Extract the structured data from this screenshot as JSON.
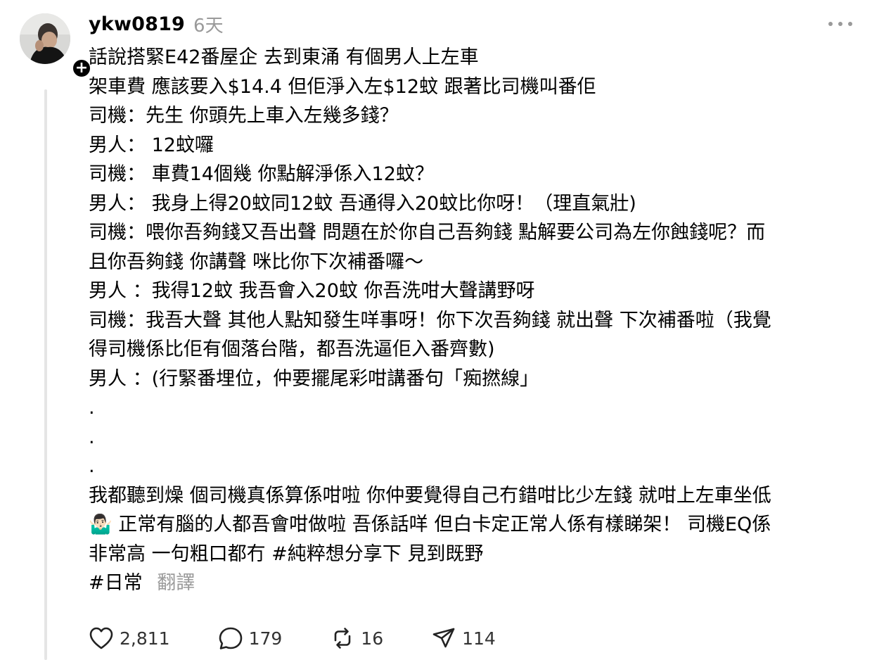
{
  "post": {
    "username": "ykw0819",
    "timestamp": "6天",
    "follow_badge": "+",
    "body_lines": [
      "話說搭緊E42番屋企 去到東涌 有個男人上左車",
      "架車費 應該要入$14.4 但佢淨入左$12蚊 跟著比司機叫番佢",
      "司機：先生 你頭先上車入左幾多錢？",
      "男人： 12蚊囉",
      "司機： 車費14個幾 你點解淨係入12蚊？",
      "男人： 我身上得20蚊同12蚊 吾通得入20蚊比你呀！（理直氣壯)",
      "司機：喂你吾夠錢又吾出聲 問題在於你自己吾夠錢 點解要公司為左你蝕錢呢？而",
      "且你吾夠錢 你講聲 咪比你下次補番囉～",
      "男人 ：我得12蚊 我吾會入20蚊 你吾洗咁大聲講野呀",
      "司機：我吾大聲 其他人點知發生咩事呀！你下次吾夠錢 就出聲 下次補番啦（我覺",
      "得司機係比佢有個落台階，都吾洗逼佢入番齊￼數)",
      "男人 ：(行緊番埋位，仲要擺尾彩咁講番句「痴撚線」",
      ".",
      ".",
      ".",
      "我都聽到燥 個司機真係算係咁啦 你仲要覺得自己冇錯咁比少左錢 就咁上左車坐低",
      "🤷🏻‍♂️ 正常有腦的人都吾會咁做啦 吾係話咩 但白卡定正常人係有樣睇架！ 司機EQ係",
      "非常高 一句粗口都冇 #純粹想分享下 見到既野"
    ],
    "hashtag": "#日常",
    "translate_label": "翻譯"
  },
  "actions": {
    "likes": "2,811",
    "comments": "179",
    "reposts": "16",
    "shares": "114"
  },
  "icons": {
    "like": "heart-icon",
    "comment": "comment-bubble-icon",
    "repost": "repost-icon",
    "share": "send-icon",
    "more": "more-dots-icon"
  },
  "colors": {
    "text": "#000000",
    "muted": "#9a9a9a",
    "thread_line": "#e5e5e5"
  }
}
